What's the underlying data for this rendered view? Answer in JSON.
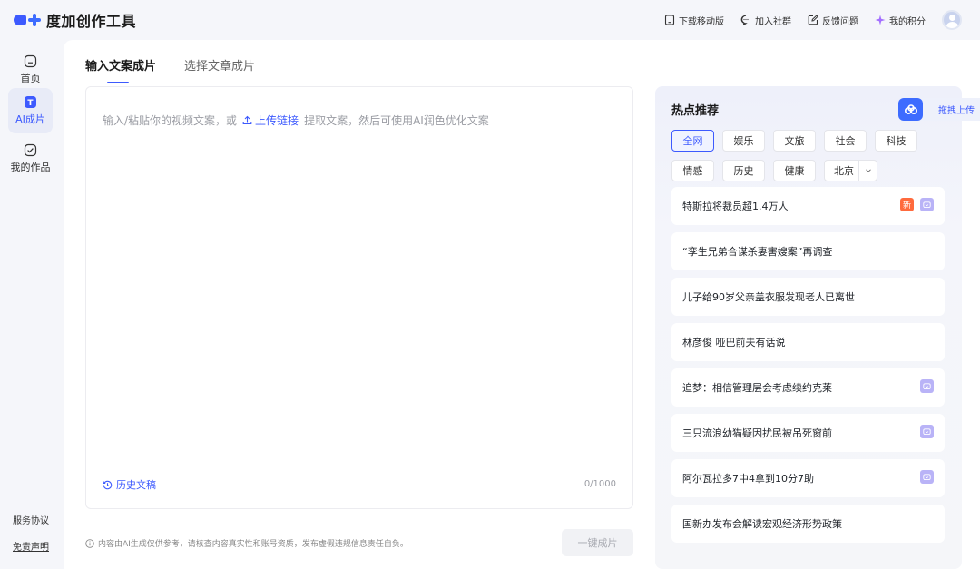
{
  "app": {
    "name": "度加创作工具"
  },
  "header": {
    "actions": [
      {
        "label": "下载移动版",
        "icon": "tablet-icon"
      },
      {
        "label": "加入社群",
        "icon": "chat-bubble-icon"
      },
      {
        "label": "反馈问题",
        "icon": "edit-square-icon"
      },
      {
        "label": "我的积分",
        "icon": "sparkle-star-icon"
      }
    ]
  },
  "sidebar": {
    "items": [
      {
        "label": "首页",
        "icon": "home-icon",
        "active": false
      },
      {
        "label": "AI成片",
        "icon": "ai-clip-icon",
        "active": true
      },
      {
        "label": "我的作品",
        "icon": "check-box-icon",
        "active": false
      }
    ],
    "links": [
      "服务协议",
      "免责声明"
    ]
  },
  "tabs": [
    {
      "label": "输入文案成片",
      "active": true
    },
    {
      "label": "选择文章成片",
      "active": false
    }
  ],
  "editor": {
    "hint_before": "输入/粘贴你的视频文案，或",
    "upload_link": "上传链接",
    "hint_after": "提取文案，然后可使用AI润色优化文案",
    "history_label": "历史文稿",
    "counter": "0/1000"
  },
  "footer": {
    "disclaimer": "内容由AI生成仅供参考，请核查内容真实性和账号资质，发布虚假违规信息责任自负。",
    "generate_button": "一键成片"
  },
  "hot": {
    "title": "热点推荐",
    "chips_row1": [
      "全网",
      "娱乐",
      "文旅",
      "社会",
      "科技"
    ],
    "chips_row2": [
      "情感",
      "历史",
      "健康"
    ],
    "region_select": "北京",
    "active_chip": "全网",
    "items": [
      {
        "title": "特斯拉将裁员超1.4万人",
        "badges": [
          "new",
          "tv"
        ],
        "new_label": "新"
      },
      {
        "title": "“孪生兄弟合谋杀妻害嫂案”再调查",
        "badges": []
      },
      {
        "title": "儿子给90岁父亲盖衣服发现老人已离世",
        "badges": []
      },
      {
        "title": "林彦俊 哑巴前夫有话说",
        "badges": []
      },
      {
        "title": "追梦：相信管理层会考虑续约克莱",
        "badges": [
          "tv"
        ]
      },
      {
        "title": "三只流浪幼猫疑因扰民被吊死窗前",
        "badges": [
          "tv"
        ]
      },
      {
        "title": "阿尔瓦拉多7中4拿到10分7助",
        "badges": [
          "tv"
        ]
      },
      {
        "title": "国新办发布会解读宏观经济形势政策",
        "badges": []
      }
    ]
  },
  "drag_upload": {
    "label": "拖拽上传",
    "icon": "cloud-link-icon"
  },
  "colors": {
    "accent": "#3d5afe",
    "new_badge": "#ff6a3d",
    "tv_badge": "#b9b3f7"
  }
}
